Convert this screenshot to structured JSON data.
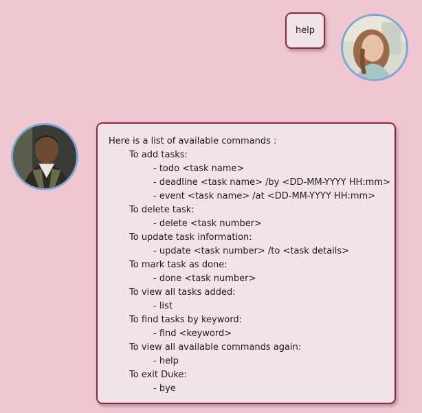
{
  "user_message": {
    "text": "help"
  },
  "bot_message": {
    "lines": [
      {
        "indent": 0,
        "text": "Here is a list of available commands :"
      },
      {
        "indent": 1,
        "text": "To add tasks:"
      },
      {
        "indent": 2,
        "text": "- todo <task name>"
      },
      {
        "indent": 2,
        "text": "- deadline <task name> /by <DD-MM-YYYY HH:mm>"
      },
      {
        "indent": 2,
        "text": "- event <task name> /at <DD-MM-YYYY HH:mm>"
      },
      {
        "indent": 1,
        "text": "To delete task:"
      },
      {
        "indent": 2,
        "text": "- delete <task number>"
      },
      {
        "indent": 1,
        "text": "To update task information:"
      },
      {
        "indent": 2,
        "text": "- update <task number> /to <task details>"
      },
      {
        "indent": 1,
        "text": "To mark task as done:"
      },
      {
        "indent": 2,
        "text": "- done <task number>"
      },
      {
        "indent": 1,
        "text": "To view all tasks added:"
      },
      {
        "indent": 2,
        "text": "- list"
      },
      {
        "indent": 1,
        "text": "To find tasks by keyword:"
      },
      {
        "indent": 2,
        "text": "- find <keyword>"
      },
      {
        "indent": 1,
        "text": "To view all available commands again:"
      },
      {
        "indent": 2,
        "text": "- help"
      },
      {
        "indent": 1,
        "text": "To exit Duke:"
      },
      {
        "indent": 2,
        "text": "- bye"
      }
    ]
  },
  "colors": {
    "background": "#f0c7d0",
    "bubble_fill": "#f1e3e7",
    "bubble_border": "#8a2846",
    "avatar_ring": "#7fa6d6"
  }
}
